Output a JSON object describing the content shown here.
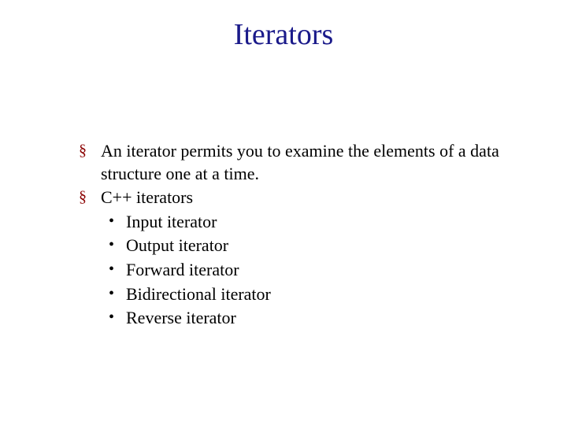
{
  "title": "Iterators",
  "bullets": {
    "b1": "An iterator permits you to examine the elements of a data structure one at a time.",
    "b2": "C++ iterators",
    "sub": {
      "s1": "Input iterator",
      "s2": "Output iterator",
      "s3": "Forward iterator",
      "s4": "Bidirectional iterator",
      "s5": "Reverse iterator"
    }
  }
}
